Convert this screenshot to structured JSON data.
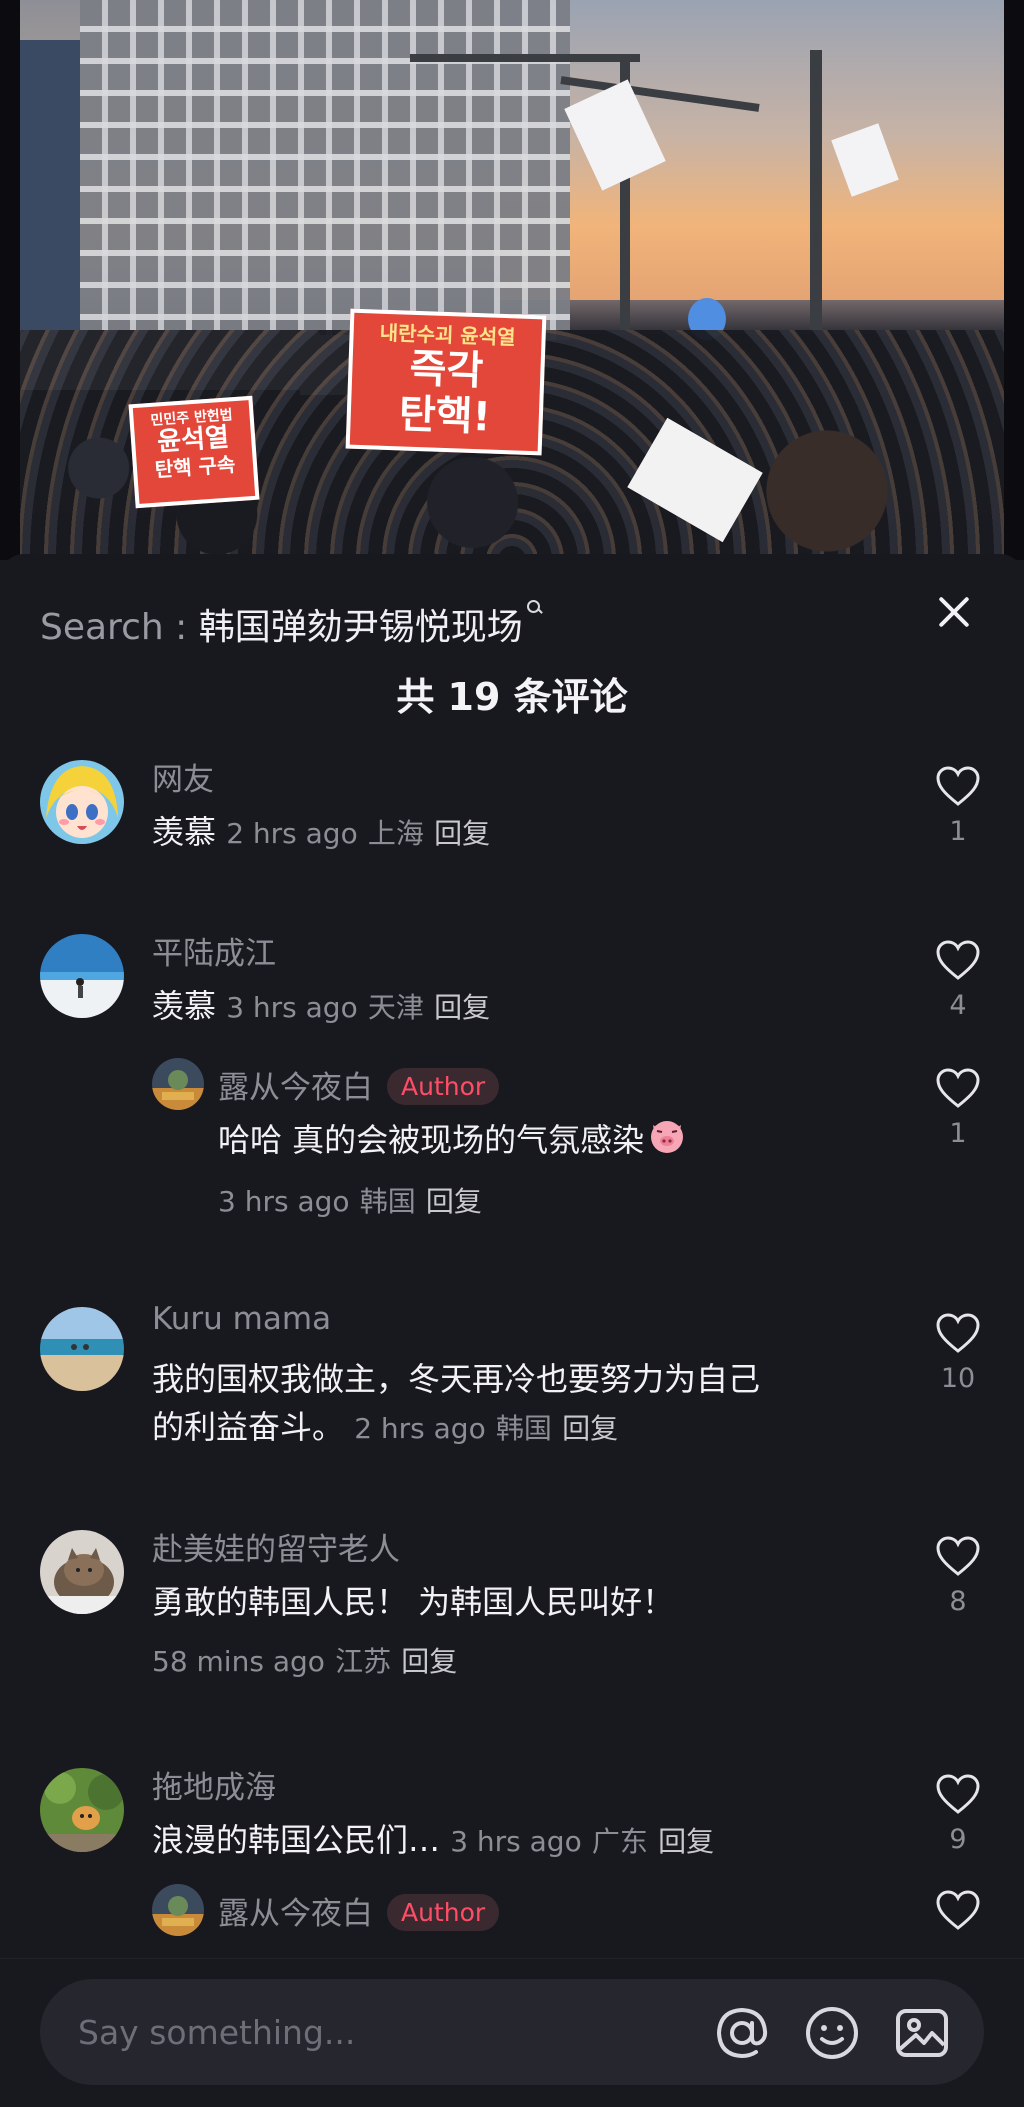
{
  "photo": {
    "signs": [
      "내란수괴 윤석열",
      "즉각",
      "탄핵!",
      "민민주 반헌법",
      "윤석열",
      "탄핵 구속"
    ]
  },
  "search": {
    "prefix": "Search : ",
    "query": "韩国弹劾尹锡悦现场"
  },
  "header": {
    "count_title": "共 19 条评论"
  },
  "comments": [
    {
      "username": "网友",
      "text": "羡慕",
      "time": "2 hrs ago",
      "location": "上海",
      "reply_label": "回复",
      "likes": "1"
    },
    {
      "username": "平陆成江",
      "text": "羡慕",
      "time": "3 hrs ago",
      "location": "天津",
      "reply_label": "回复",
      "likes": "4",
      "reply": {
        "username": "露从今夜白",
        "badge": "Author",
        "text": "哈哈 真的会被现场的气氛感染",
        "time": "3 hrs ago",
        "location": "韩国",
        "reply_label": "回复",
        "likes": "1"
      }
    },
    {
      "username": "Kuru mama",
      "text_line1": "我的国权我做主，冬天再冷也要努力为自己",
      "text_line2": "的利益奋斗。",
      "time": "2 hrs ago",
      "location": "韩国",
      "reply_label": "回复",
      "likes": "10"
    },
    {
      "username": "赴美娃的留守老人",
      "text": "勇敢的韩国人民！ 为韩国人民叫好！",
      "time": "58 mins ago",
      "location": "江苏",
      "reply_label": "回复",
      "likes": "8"
    },
    {
      "username": "拖地成海",
      "text": "浪漫的韩国公民们…",
      "time": "3 hrs ago",
      "location": "广东",
      "reply_label": "回复",
      "likes": "9",
      "reply": {
        "username": "露从今夜白",
        "badge": "Author"
      }
    }
  ],
  "composer": {
    "placeholder": "Say something...",
    "icons": [
      "at-icon",
      "emoji-icon",
      "image-icon"
    ]
  },
  "colors": {
    "background": "#18181f",
    "author_badge": "#ff4d68",
    "input_bg": "#26262e"
  }
}
